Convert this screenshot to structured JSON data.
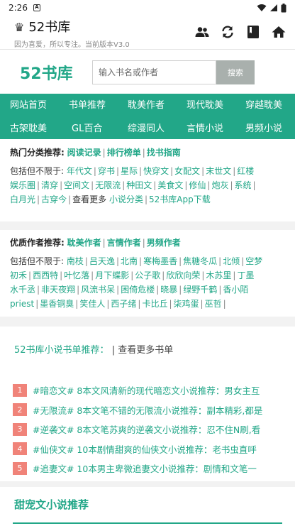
{
  "status": {
    "time": "2:26",
    "notif_letter": "A"
  },
  "appbar": {
    "title": "52书库",
    "subtitle": "因为喜爱，所以专注。当前版本V3.0"
  },
  "brand": {
    "logo": "52书库",
    "search_placeholder": "输入书名或作者",
    "search_button": "搜索"
  },
  "nav": {
    "row1": [
      "网站首页",
      "书单推荐",
      "耽美作者",
      "现代耽美",
      "穿越耽美"
    ],
    "row2": [
      "古架耽美",
      "GL百合",
      "综漫同人",
      "言情小说",
      "男频小说"
    ]
  },
  "hot_categories": {
    "label": "热门分类推荐:",
    "links": [
      "阅读记录",
      "排行榜单",
      "找书指南"
    ],
    "includes_label": "包括但不限于:",
    "tags": [
      "年代文",
      "穿书",
      "星际",
      "快穿文",
      "女配文",
      "末世文",
      "红楼",
      "娱乐圈",
      "清穿",
      "空间文",
      "无限流",
      "种田文",
      "美食文",
      "修仙",
      "炮灰",
      "系统",
      "白月光",
      "古穿今"
    ],
    "more_text": "查看更多",
    "more_link": "小说分类",
    "app_link": "52书库App下载"
  },
  "authors": {
    "label": "优质作者推荐:",
    "links": [
      "耽美作者",
      "言情作者",
      "男频作者"
    ],
    "includes_label": "包括但不限于:",
    "names": [
      "南枝",
      "吕天逸",
      "北南",
      "寒梅墨香",
      "焦糖冬瓜",
      "北倾",
      "空梦",
      "初禾",
      "西西特",
      "叶忆落",
      "月下蝶影",
      "公子歌",
      "欣欣向荣",
      "木苏里",
      "丁墨",
      "水千丞",
      "非天夜翔",
      "风流书呆",
      "困倚危楼",
      "晓暴",
      "绿野千鹤",
      "香小陌",
      "priest",
      "墨香铜臭",
      "笑佳人",
      "西子绪",
      "卡比丘",
      "柒鸡蛋",
      "巫哲"
    ]
  },
  "recommend": {
    "title": "52书库小说书单推荐：",
    "more": "| 查看更多书单",
    "items": [
      {
        "num": "1",
        "text": "#暗恋文# 8本文风清新的现代暗恋文小说推荐：男女主互"
      },
      {
        "num": "2",
        "text": "#无限流# 8本文笔不错的无限流小说推荐：副本精彩,都是"
      },
      {
        "num": "3",
        "text": "#逆袭文# 8本文笔苏爽的逆袭文小说推荐：忍不住N刷,看"
      },
      {
        "num": "4",
        "text": "#仙侠文# 10本剧情甜爽的仙侠文小说推荐：老书虫直呼"
      },
      {
        "num": "5",
        "text": "#追妻文# 10本男主卑微追妻文小说推荐：剧情和文笔一"
      }
    ]
  },
  "sweet": {
    "title": "甜宠文小说推荐"
  }
}
